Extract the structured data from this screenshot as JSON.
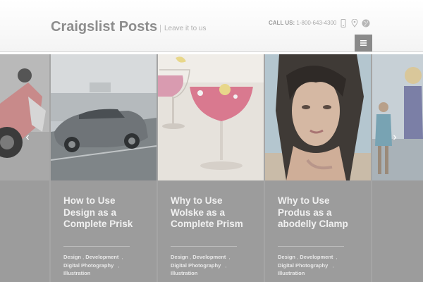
{
  "header": {
    "site_title": "Craigslist Posts",
    "tagline": "Leave it to us",
    "call_label": "CALL US:",
    "phone": "1-800-643-4300",
    "icons": [
      "phone-icon",
      "map-marker-icon",
      "globe-icon"
    ]
  },
  "menu": {
    "icon": "hamburger-menu-icon"
  },
  "slider": {
    "prev_icon": "chevron-left-icon",
    "next_icon": "chevron-right-icon",
    "prev_glyph": "‹",
    "next_glyph": "›",
    "posts": [
      {
        "image": "car-photo",
        "title": "How to Use Design as a Complete Prisk",
        "categories": [
          "Design",
          "Development",
          "Digital Photography",
          "Illustration"
        ]
      },
      {
        "image": "cocktail-photo",
        "title": "Why to Use Wolske as a Complete Prism",
        "categories": [
          "Design",
          "Development",
          "Digital Photography",
          "Illustration"
        ]
      },
      {
        "image": "portrait-photo",
        "title": "Why to Use Produs as a abodelly Clamp",
        "categories": [
          "Design",
          "Development",
          "Digital Photography",
          "Illustration"
        ]
      }
    ]
  },
  "colors": {
    "overlay": "#9c9c9c",
    "menu_button": "#8a8a8a",
    "logo": "#8d8d8d"
  }
}
